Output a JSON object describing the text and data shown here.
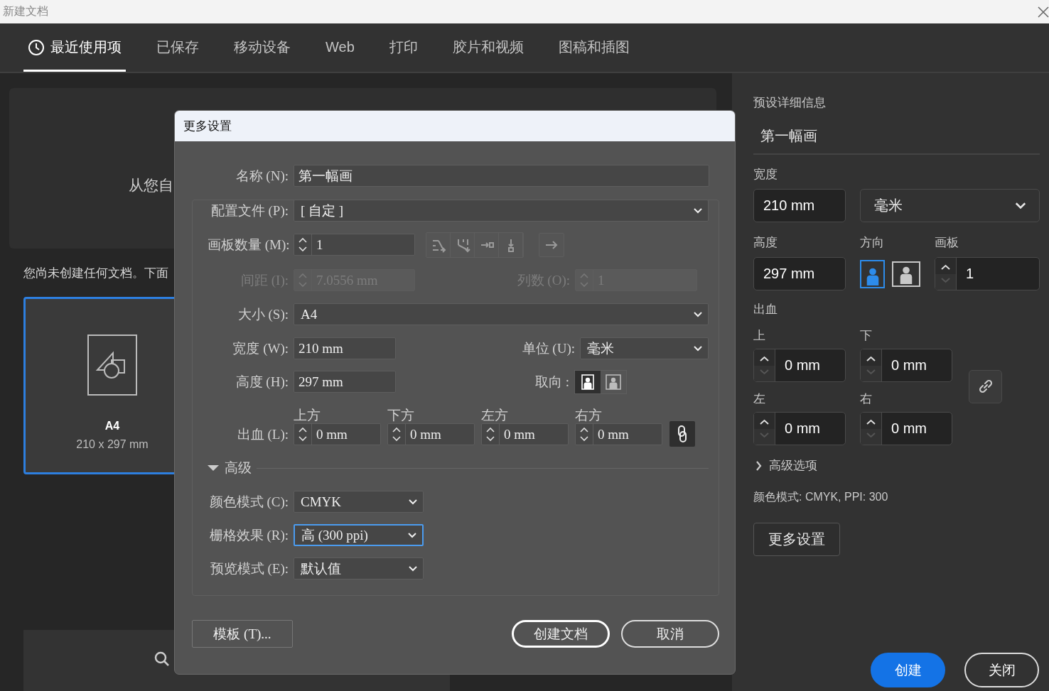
{
  "window": {
    "title": "新建文档"
  },
  "tabs": [
    {
      "label": "最近使用项",
      "selected": true
    },
    {
      "label": "已保存",
      "selected": false
    },
    {
      "label": "移动设备",
      "selected": false
    },
    {
      "label": "Web",
      "selected": false
    },
    {
      "label": "打印",
      "selected": false
    },
    {
      "label": "胶片和视频",
      "selected": false
    },
    {
      "label": "图稿和插图",
      "selected": false
    }
  ],
  "recent": {
    "banner_text": "从您自",
    "message": "您尚未创建任何文档。下面",
    "presets": [
      {
        "name": "A4",
        "size": "210 x 297 mm",
        "selected": true
      }
    ]
  },
  "dialog": {
    "title": "更多设置",
    "name": {
      "label": "名称 (N):",
      "value": "第一幅画"
    },
    "profile": {
      "label": "配置文件 (P):",
      "value": "[ 自定 ]"
    },
    "artboards": {
      "label": "画板数量 (M):",
      "value": "1"
    },
    "spacing": {
      "label": "间距 (I):",
      "value": "7.0556 mm",
      "disabled": true
    },
    "columns": {
      "label": "列数 (O):",
      "value": "1",
      "disabled": true
    },
    "size": {
      "label": "大小 (S):",
      "value": "A4"
    },
    "width": {
      "label": "宽度 (W):",
      "value": "210 mm"
    },
    "units": {
      "label": "单位 (U):",
      "value": "毫米"
    },
    "height": {
      "label": "高度 (H):",
      "value": "297 mm"
    },
    "orientation": {
      "label": "取向 :",
      "options": [
        {
          "kind": "portrait",
          "selected": true
        },
        {
          "kind": "landscape",
          "selected": false
        }
      ]
    },
    "bleed": {
      "label": "出血 (L):",
      "sides": [
        {
          "label": "上方",
          "value": "0 mm"
        },
        {
          "label": "下方",
          "value": "0 mm"
        },
        {
          "label": "左方",
          "value": "0 mm"
        },
        {
          "label": "右方",
          "value": "0 mm"
        }
      ]
    },
    "advanced": {
      "label": "高级",
      "expanded": true
    },
    "color_mode": {
      "label": "颜色模式 (C):",
      "value": "CMYK",
      "focused": false
    },
    "raster_effects": {
      "label": "栅格效果 (R):",
      "value": "高 (300 ppi)",
      "focused": true
    },
    "preview_mode": {
      "label": "预览模式 (E):",
      "value": "默认值",
      "focused": false
    },
    "buttons": [
      {
        "label": "模板 (T)...",
        "kind": "plain"
      },
      {
        "label": "创建文档",
        "kind": "default"
      },
      {
        "label": "取消",
        "kind": "cancel"
      }
    ]
  },
  "preset_details": {
    "heading": "预设详细信息",
    "name": "第一幅画",
    "width": {
      "label": "宽度",
      "value": "210 mm"
    },
    "units": "毫米",
    "height": {
      "label": "高度",
      "value": "297 mm"
    },
    "orientation": {
      "label": "方向",
      "options": [
        {
          "kind": "portrait",
          "selected": true
        },
        {
          "kind": "landscape",
          "selected": false
        }
      ]
    },
    "artboards": {
      "label": "画板",
      "value": "1"
    },
    "bleed": {
      "label": "出血",
      "sides": [
        {
          "label": "上",
          "value": "0 mm"
        },
        {
          "label": "下",
          "value": "0 mm"
        },
        {
          "label": "左",
          "value": "0 mm"
        },
        {
          "label": "右",
          "value": "0 mm"
        }
      ]
    },
    "advanced_options": {
      "label": "高级选项",
      "expanded": false
    },
    "summary": "颜色模式: CMYK, PPI: 300",
    "more_settings": "更多设置"
  },
  "footer_buttons": [
    {
      "label": "创建",
      "kind": "primary"
    },
    {
      "label": "关闭",
      "kind": "secondary"
    }
  ]
}
